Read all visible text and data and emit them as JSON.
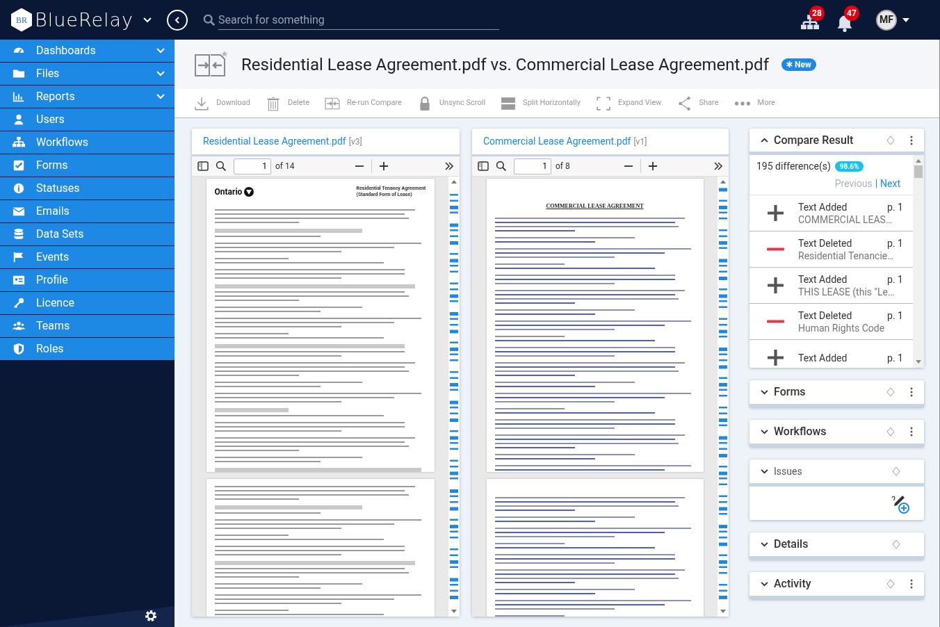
{
  "brand": {
    "logo_text": "BR",
    "name": "BlueRelay"
  },
  "search": {
    "placeholder": "Search for something"
  },
  "header_icons": [
    {
      "kind": "sitemap",
      "count": "28"
    },
    {
      "kind": "bell",
      "count": "47"
    }
  ],
  "user": {
    "initials": "MF"
  },
  "sidebar": {
    "items": [
      {
        "label": "Dashboards",
        "expandable": true
      },
      {
        "label": "Files",
        "expandable": true
      },
      {
        "label": "Reports",
        "expandable": true
      },
      {
        "label": "Users",
        "expandable": false
      },
      {
        "label": "Workflows",
        "expandable": false
      },
      {
        "label": "Forms",
        "expandable": false
      },
      {
        "label": "Statuses",
        "expandable": false
      },
      {
        "label": "Emails",
        "expandable": false
      },
      {
        "label": "Data Sets",
        "expandable": false
      },
      {
        "label": "Events",
        "expandable": false
      },
      {
        "label": "Profile",
        "expandable": false
      },
      {
        "label": "Licence",
        "expandable": false
      },
      {
        "label": "Teams",
        "expandable": false
      },
      {
        "label": "Roles",
        "expandable": false
      }
    ]
  },
  "document": {
    "title": "Residential Lease Agreement.pdf vs. Commercial Lease Agreement.pdf",
    "badge": "New"
  },
  "toolbar": [
    "Download",
    "Delete",
    "Re-run Compare",
    "Unsync Scroll",
    "Split Horizontally",
    "Expand View",
    "Share",
    "More"
  ],
  "viewers": [
    {
      "file": "Residential Lease Agreement.pdf",
      "version": "[v3]",
      "page": "1",
      "page_count": "of 14",
      "pages": [
        {
          "kind": "form",
          "logo_text": "Ontario",
          "title_lines": [
            "Residential Tenancy Agreement",
            "(Standard Form of Lease)"
          ]
        },
        {
          "kind": "form"
        }
      ]
    },
    {
      "file": "Commercial Lease Agreement.pdf",
      "version": "[v1]",
      "page": "1",
      "page_count": "of 8",
      "pages": [
        {
          "kind": "lease",
          "title_lines": [
            "COMMERCIAL LEASE AGREEMENT"
          ]
        },
        {
          "kind": "lease"
        }
      ]
    }
  ],
  "compare": {
    "title": "Compare Result",
    "expanded": true,
    "count": "195 difference(s)",
    "score": "98.6%",
    "previous": "Previous",
    "separator": "|",
    "next": "Next",
    "differences": [
      {
        "kind": "added",
        "type": "Text Added",
        "page": "p. 1",
        "excerpt": "COMMERCIAL LEAS…"
      },
      {
        "kind": "deleted",
        "type": "Text Deleted",
        "page": "p. 1",
        "excerpt": "Residential Tenancie…"
      },
      {
        "kind": "added",
        "type": "Text Added",
        "page": "p. 1",
        "excerpt": "THIS LEASE (this \"Le…"
      },
      {
        "kind": "deleted",
        "type": "Text Deleted",
        "page": "p. 1",
        "excerpt": "Human Rights Code"
      },
      {
        "kind": "added",
        "type": "Text Added",
        "page": "p. 1"
      }
    ]
  },
  "panels": [
    {
      "title": "Forms",
      "kind": "section",
      "menu": true
    },
    {
      "title": "Workflows",
      "kind": "section",
      "menu": true
    },
    {
      "title": "Issues",
      "kind": "issues",
      "menu": false
    },
    {
      "title": "Details",
      "kind": "section",
      "menu": false
    },
    {
      "title": "Activity",
      "kind": "section",
      "menu": true
    }
  ]
}
